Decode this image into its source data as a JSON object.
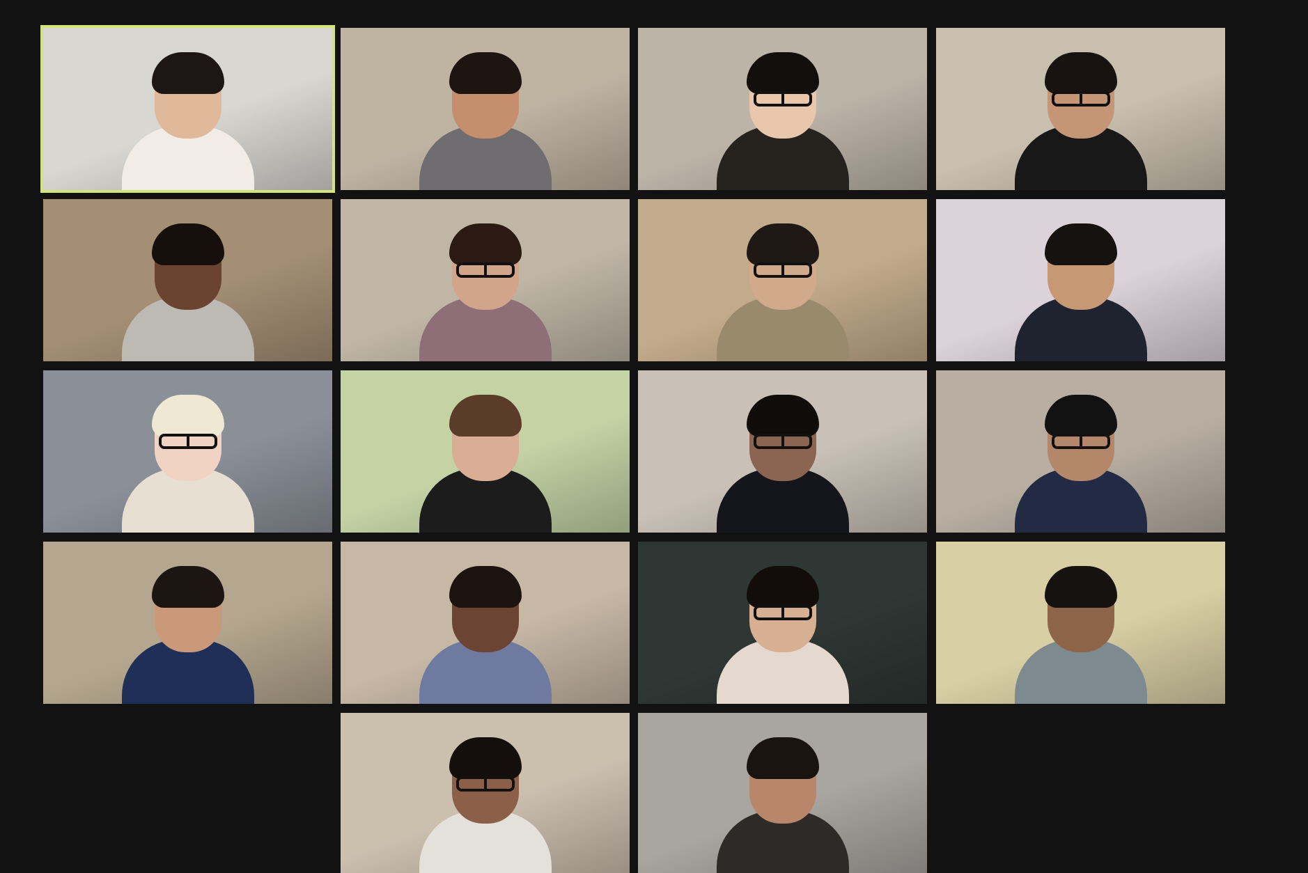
{
  "meeting": {
    "view": "gallery",
    "active_speaker_index": 0,
    "accent_color": "#d4e47c"
  },
  "tiles": [
    {
      "bg": "#d9d7d2",
      "skin": "#e0b99a",
      "hair": "#1c1714",
      "shirt": "#f1ece6",
      "glasses": false
    },
    {
      "bg": "#bfb3a2",
      "skin": "#c58e6c",
      "hair": "#1e1510",
      "shirt": "#6f6d6f",
      "glasses": false
    },
    {
      "bg": "#bdb4a8",
      "skin": "#e9c7ad",
      "hair": "#120e0c",
      "shirt": "#26231f",
      "glasses": true
    },
    {
      "bg": "#c9bfae",
      "skin": "#c49676",
      "hair": "#181310",
      "shirt": "#181818",
      "glasses": true
    },
    {
      "bg": "#a48f75",
      "skin": "#6b4331",
      "hair": "#160f0b",
      "shirt": "#bdbab4",
      "glasses": false
    },
    {
      "bg": "#bfb6a6",
      "skin": "#d2a48a",
      "hair": "#2a1a11",
      "shirt": "#8e6f77",
      "glasses": true
    },
    {
      "bg": "#c2ab8a",
      "skin": "#d1a98b",
      "hair": "#1f1814",
      "shirt": "#9a8a6c",
      "glasses": true
    },
    {
      "bg": "#dcd2d9",
      "skin": "#c69874",
      "hair": "#161210",
      "shirt": "#1f2330",
      "glasses": false
    },
    {
      "bg": "#8b8f98",
      "skin": "#f0d3c3",
      "hair": "#efe9d3",
      "shirt": "#e8dfd3",
      "glasses": true
    },
    {
      "bg": "#c4d2a4",
      "skin": "#d9ae94",
      "hair": "#5a3c28",
      "shirt": "#1c1c1c",
      "glasses": false
    },
    {
      "bg": "#c9c1b7",
      "skin": "#8b6552",
      "hair": "#100c0a",
      "shirt": "#15161b",
      "glasses": true
    },
    {
      "bg": "#b8aea2",
      "skin": "#b4876a",
      "hair": "#121212",
      "shirt": "#232b44",
      "glasses": true
    },
    {
      "bg": "#b5a78f",
      "skin": "#c9997a",
      "hair": "#1d1512",
      "shirt": "#1f2f58",
      "glasses": false
    },
    {
      "bg": "#c7b8a6",
      "skin": "#6b4433",
      "hair": "#1c130f",
      "shirt": "#6e7aa0",
      "glasses": false
    },
    {
      "bg": "#2e3734",
      "skin": "#d7af92",
      "hair": "#120d0b",
      "shirt": "#e4d8cf",
      "glasses": true
    },
    {
      "bg": "#d9cfa5",
      "skin": "#8f6549",
      "hair": "#161210",
      "shirt": "#7d8a90",
      "glasses": false
    },
    {
      "bg": "#cbbfae",
      "skin": "#8c5f48",
      "hair": "#140f0c",
      "shirt": "#e4e0da",
      "glasses": true
    },
    {
      "bg": "#a9a5a1",
      "skin": "#b8866a",
      "hair": "#1a1411",
      "shirt": "#2e2a28",
      "glasses": false
    }
  ]
}
